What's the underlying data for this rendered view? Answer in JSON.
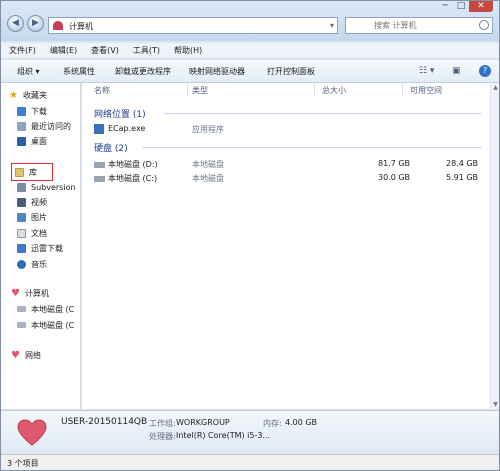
{
  "title_bar": {
    "path_label": "计算机",
    "search_placeholder": "搜索 计算机",
    "controls": {
      "minimize": "─",
      "maximize": "□",
      "close": "✕"
    }
  },
  "menu": [
    "文件(F)",
    "编辑(E)",
    "查看(V)",
    "工具(T)",
    "帮助(H)"
  ],
  "toolbar": {
    "organize": "组织 ▾",
    "system_properties": "系统属性",
    "uninstall": "卸载或更改程序",
    "map_drive": "映射网络驱动器",
    "control_panel": "打开控制面板"
  },
  "nav": {
    "favorites": "收藏夹",
    "downloads": "下载",
    "recent": "最近访问的",
    "desktop": "桌面",
    "libraries": "库",
    "subversion": "Subversion",
    "videos": "视频",
    "pictures": "图片",
    "documents": "文档",
    "thunder_downloads": "迅雷下载",
    "music": "音乐",
    "computer": "计算机",
    "local_disk_d": "本地磁盘 (C",
    "local_disk_c": "本地磁盘 (C",
    "network": "网络"
  },
  "columns": {
    "name": "名称",
    "type": "类型",
    "total": "总大小",
    "free": "可用空间"
  },
  "groups": {
    "network_location": "网络位置 (1)",
    "hard_disk": "硬盘 (2)"
  },
  "network_items": [
    {
      "name": "ECap.exe",
      "type": "应用程序"
    }
  ],
  "drives": [
    {
      "name": "本地磁盘 (D:)",
      "type": "本地磁盘",
      "total": "81.7 GB",
      "free": "28.4 GB"
    },
    {
      "name": "本地磁盘 (C:)",
      "type": "本地磁盘",
      "total": "30.0 GB",
      "free": "5.91 GB"
    }
  ],
  "details": {
    "computer_name": "USER-20150114QB",
    "workgroup_key": "工作组:",
    "workgroup_val": "WORKGROUP",
    "memory_key": "内存:",
    "memory_val": "4.00 GB",
    "processor_key": "处理器:",
    "processor_val": "Intel(R) Core(TM) i5-3..."
  },
  "status": "3 个项目",
  "colors": {
    "frame": "#dbe6f3",
    "group_text": "#1e3d8f",
    "highlight_box": "#e02a2a",
    "heart": "#e0586f"
  }
}
